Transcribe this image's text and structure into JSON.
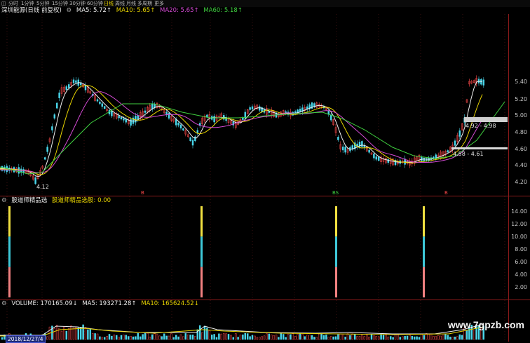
{
  "toolbar": {
    "items": [
      {
        "label": "分时"
      },
      {
        "label": "1分钟"
      },
      {
        "label": "5分钟"
      },
      {
        "label": "15分钟"
      },
      {
        "label": "30分钟"
      },
      {
        "label": "60分钟"
      },
      {
        "label": "日线"
      },
      {
        "label": "周线"
      },
      {
        "label": "月线"
      },
      {
        "label": "多周期"
      },
      {
        "label": "更多"
      }
    ]
  },
  "price_panel": {
    "title": "深圳能源(日线 前复权)",
    "ma5": "MA5: 5.72↑",
    "ma10": "MA10: 5.65↑",
    "ma20": "MA20: 5.65↑",
    "ma60": "MA60: 5.18↑",
    "low_label": "4.12",
    "range_upper": "4.92 - 4.98",
    "range_lower": "4.58 - 4.61",
    "y_ticks": [
      "5.40",
      "5.20",
      "5.00",
      "4.80",
      "4.60",
      "4.40",
      "4.20"
    ],
    "marker_1": "B",
    "marker_2": "BS",
    "marker_3": "B"
  },
  "indicator_panel": {
    "title": "股道师精品选",
    "label": "股道师精品选股: 0.00",
    "y_ticks": [
      "14.00",
      "12.00",
      "10.00",
      "8.00",
      "6.00",
      "4.00",
      "2.00"
    ]
  },
  "volume_panel": {
    "volume": "VOLUME: 170165.09↓",
    "ma5": "MA5: 193271.28↑",
    "ma10": "MA10: 165624.52↓"
  },
  "date_badge": "2018/12/27/4",
  "watermark": "www.7gpzb.com",
  "colors": {
    "up": "#ff4a4a",
    "down": "#49d4e8",
    "ma5": "#f0f0f0",
    "ma10": "#e8d400",
    "ma20": "#d44ad4",
    "ma60": "#3fcf3f",
    "bar_top": "#f0e040",
    "bar_mid": "#3ec8d8",
    "bar_bottom": "#f08080"
  }
}
